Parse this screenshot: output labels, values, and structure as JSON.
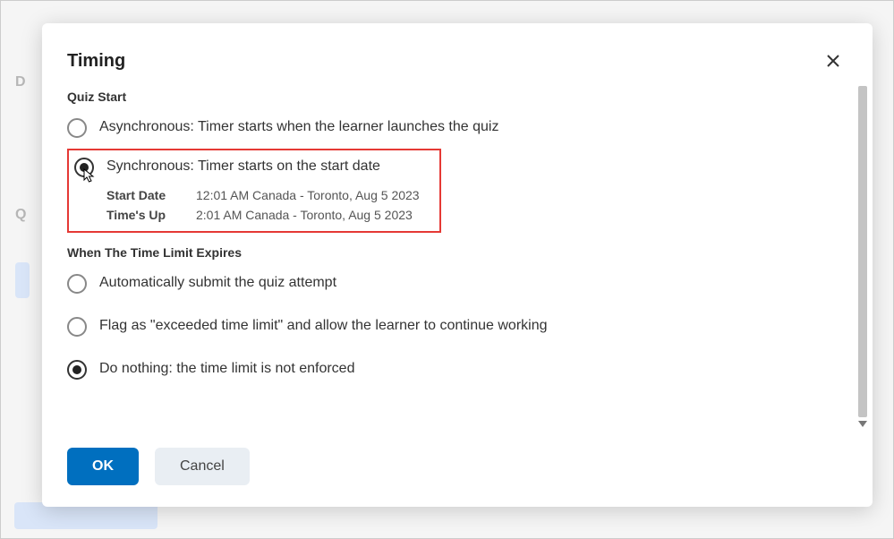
{
  "modal": {
    "title": "Timing",
    "close_label": "Close"
  },
  "quiz_start": {
    "section_title": "Quiz Start",
    "async_label": "Asynchronous: Timer starts when the learner launches the quiz",
    "sync_label": "Synchronous: Timer starts on the start date",
    "selected": "sync",
    "details": {
      "start_date_key": "Start Date",
      "start_date_value": "12:01 AM Canada - Toronto, Aug 5 2023",
      "times_up_key": "Time's Up",
      "times_up_value": "2:01 AM Canada - Toronto, Aug 5 2023"
    }
  },
  "expiry": {
    "section_title": "When The Time Limit Expires",
    "options": {
      "auto_submit": "Automatically submit the quiz attempt",
      "flag_exceeded": "Flag as \"exceeded time limit\" and allow the learner to continue working",
      "do_nothing": "Do nothing: the time limit is not enforced"
    },
    "selected": "do_nothing"
  },
  "footer": {
    "ok": "OK",
    "cancel": "Cancel"
  },
  "backdrop": {
    "d": "D",
    "q": "Q"
  }
}
